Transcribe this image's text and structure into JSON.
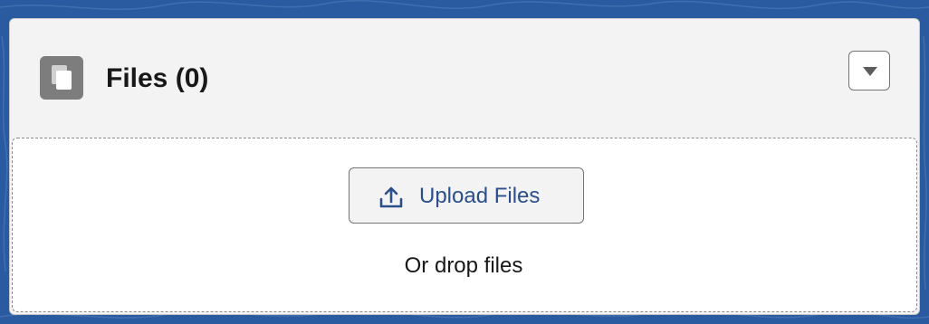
{
  "card": {
    "title": "Files (0)"
  },
  "upload": {
    "button_label": "Upload Files",
    "drop_text": "Or drop files"
  },
  "icons": {
    "header": "files-icon",
    "menu": "caret-down-icon",
    "upload": "upload-icon"
  },
  "colors": {
    "background": "#2a5aa0",
    "card_header": "#f3f3f3",
    "header_icon": "#7d7d7d",
    "upload_label": "#2b4f8a"
  }
}
